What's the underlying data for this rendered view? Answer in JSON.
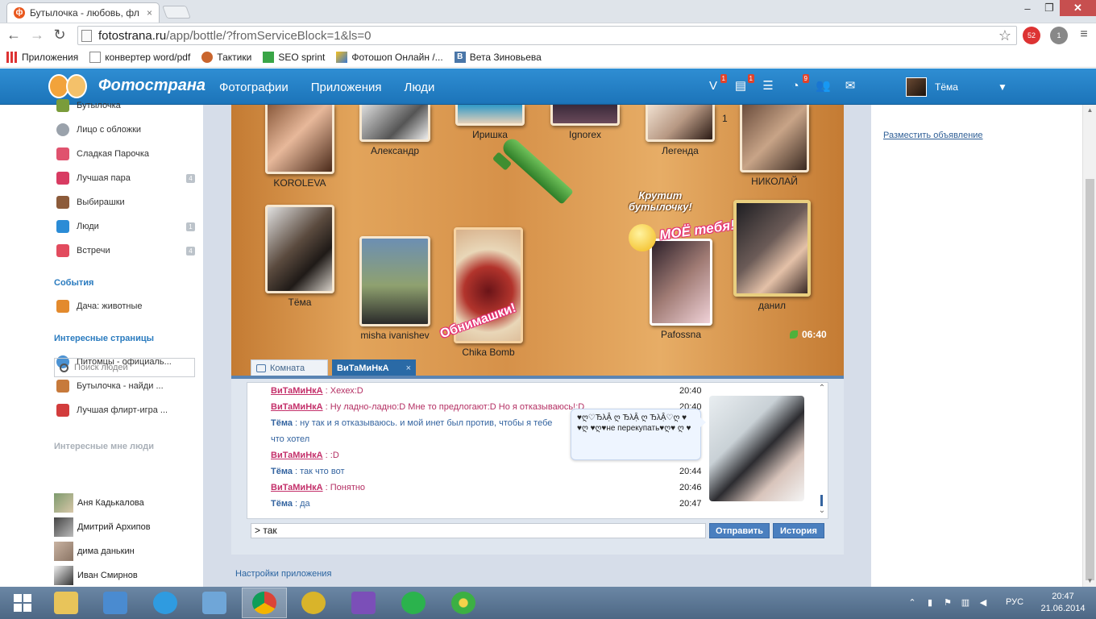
{
  "browser": {
    "tab_title": "Бутылочка - любовь, фл",
    "tab_close": "×",
    "url_host": "fotostrana.ru",
    "url_rest": "/app/bottle/?fromServiceBlock=1&ls=0",
    "ext_badge_1": "52",
    "ext_badge_2": "1",
    "bookmarks": [
      "Приложения",
      "конвертер word/pdf",
      "Тактики",
      "SEO sprint",
      "Фотошоп Онлайн /...",
      "Вета Зиновьева"
    ]
  },
  "site": {
    "logo": "Фотострана",
    "nav": [
      "Фотографии",
      "Приложения",
      "Люди"
    ],
    "badges": {
      "v": "1",
      "list": "1",
      "pie": "9"
    },
    "user_name": "Тёма"
  },
  "sidebar": {
    "items": [
      {
        "label": "Бутылочка"
      },
      {
        "label": "Лицо с обложки"
      },
      {
        "label": "Сладкая Парочка"
      },
      {
        "label": "Лучшая пара",
        "badge": "4"
      },
      {
        "label": "Выбирашки"
      },
      {
        "label": "Люди",
        "badge": "1"
      },
      {
        "label": "Встречи",
        "badge": "4"
      }
    ],
    "events_heading": "События",
    "events": [
      {
        "label": "Дача: животные"
      }
    ],
    "pages_heading": "Интересные страницы",
    "pages": [
      {
        "label": "Питомцы - официаль..."
      },
      {
        "label": "Бутылочка - найди ..."
      },
      {
        "label": "Лучшая флирт-игра ..."
      }
    ],
    "people_heading": "Интересные мне люди",
    "search_placeholder": "Поиск людей",
    "people": [
      {
        "name": "Аня Кадькалова"
      },
      {
        "name": "Дмитрий Архипов"
      },
      {
        "name": "дима данькин"
      },
      {
        "name": "Иван Смирнов"
      }
    ]
  },
  "game": {
    "players": [
      "KOROLEVA",
      "Александр",
      "Иришка",
      "Ignorex",
      "Легенда",
      "НИКОЛАЙ",
      "Тёма",
      "misha ivanishev",
      "Chika Bomb",
      "Pafossna",
      "данил"
    ],
    "heart_count": "1",
    "spin_text_1": "Крутит",
    "spin_text_2": "бутылочку!",
    "moe_text": "МОЁ тебя!",
    "hug_text": "Обнимашки!",
    "timer": "06:40"
  },
  "chat": {
    "tabs": {
      "room": "Комната",
      "private": "ВиТаМиНкА",
      "close": "×"
    },
    "messages": [
      {
        "author": "ВиТаМиНкА",
        "text": ": Хехех:D",
        "time": "20:40",
        "who": "her"
      },
      {
        "author": "ВиТаМиНкА",
        "text": ": Ну ладно-ладно:D Мне то предлогают:D Но я отказываюсь!:D",
        "time": "20:40",
        "who": "her"
      },
      {
        "author": "Тёма",
        "text": ": ну так и я отказываюсь. и мой инет был против, чтобы я тебе",
        "time": "",
        "who": "me"
      },
      {
        "author": "",
        "text": "что хотел",
        "time": "",
        "who": "me"
      },
      {
        "author": "ВиТаМиНкА",
        "text": ": :D",
        "time": "",
        "who": "her"
      },
      {
        "author": "Тёма",
        "text": ": так что вот",
        "time": "20:44",
        "who": "me"
      },
      {
        "author": "ВиТаМиНкА",
        "text": ": Понятно",
        "time": "20:46",
        "who": "her"
      },
      {
        "author": "Тёма",
        "text": ": да",
        "time": "20:47",
        "who": "me"
      }
    ],
    "status_line_1": "♥ღ♡ЂλẬ ღ ЂλẬ ღ ЂλẬ♡ღ ♥",
    "status_line_2": "♥ღ ♥ღ♥не перекупать♥ღ♥ ღ ♥",
    "input_value": "> так",
    "send_label": "Отправить",
    "history_label": "История"
  },
  "app_settings": "Настройки приложения",
  "right": {
    "ad_link": "Разместить объявление"
  },
  "tray": {
    "lang": "РУС",
    "time": "20:47",
    "date": "21.06.2014"
  }
}
